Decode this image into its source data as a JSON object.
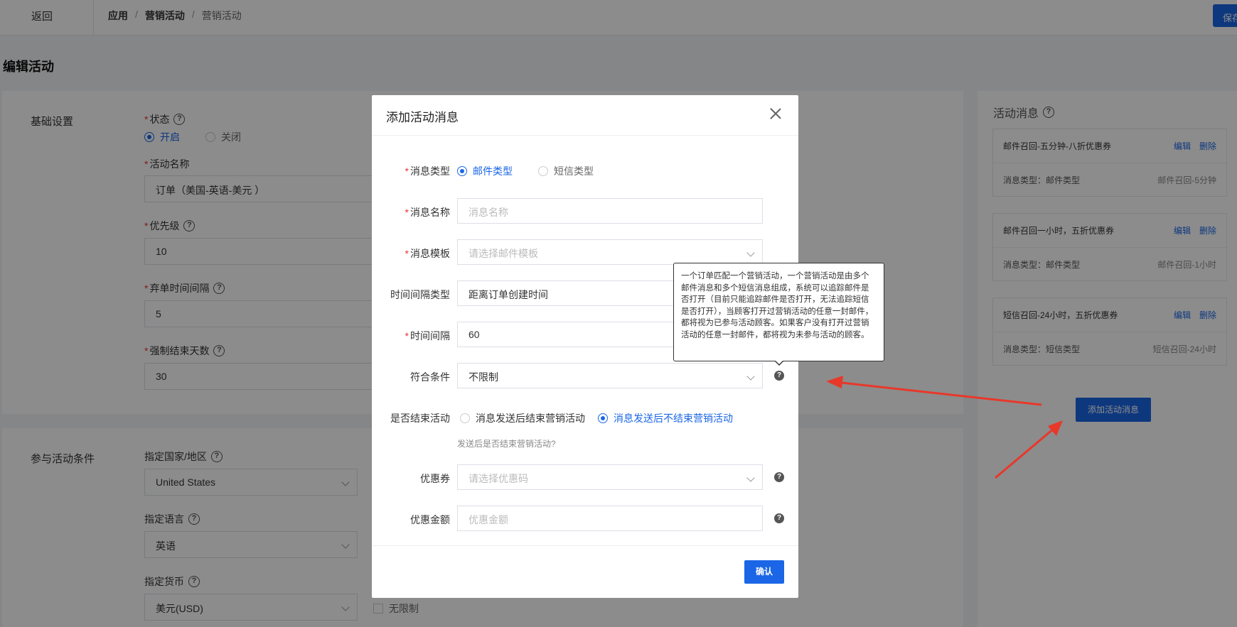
{
  "topbar": {
    "back_label": "返回",
    "breadcrumb": [
      "应用",
      "营销活动",
      "营销活动"
    ],
    "save_label": "保存"
  },
  "page_title": "编辑活动",
  "basic": {
    "section_title": "基础设置",
    "status_label": "状态",
    "status_on": "开启",
    "status_off": "关闭",
    "name_label": "活动名称",
    "name_value": "订单（美国-英语-美元 ）",
    "priority_label": "优先级",
    "priority_value": "10",
    "abandon_label": "弃单时间间隔",
    "abandon_value": "5",
    "force_end_label": "强制结束天数",
    "force_end_value": "30"
  },
  "conditions": {
    "section_title": "参与活动条件",
    "country_label": "指定国家/地区",
    "country_value": "United States",
    "language_label": "指定语言",
    "language_value": "英语",
    "currency_label": "指定货币",
    "currency_value": "美元(USD)",
    "unlimited_label": "无限制"
  },
  "messages": {
    "title": "活动消息",
    "items": [
      {
        "name": "邮件召回-五分钟-八折优惠券",
        "edit": "编辑",
        "delete": "删除",
        "type": "消息类型：邮件类型",
        "tpl": "邮件召回-5分钟"
      },
      {
        "name": "邮件召回一小时，五折优惠券",
        "edit": "编辑",
        "delete": "删除",
        "type": "消息类型：邮件类型",
        "tpl": "邮件召回-1小时"
      },
      {
        "name": "短信召回-24小时，五折优惠券",
        "edit": "编辑",
        "delete": "删除",
        "type": "消息类型：短信类型",
        "tpl": "短信召回-24小时"
      }
    ],
    "add_label": "添加活动消息"
  },
  "modal": {
    "title": "添加活动消息",
    "msg_type_label": "消息类型",
    "msg_type_email": "邮件类型",
    "msg_type_sms": "短信类型",
    "msg_name_label": "消息名称",
    "msg_name_placeholder": "消息名称",
    "msg_tpl_label": "消息模板",
    "msg_tpl_placeholder": "请选择邮件模板",
    "interval_type_label": "时间间隔类型",
    "interval_type_value": "距离订单创建时间",
    "interval_label": "时间间隔",
    "interval_value": "60",
    "condition_label": "符合条件",
    "condition_value": "不限制",
    "end_label": "是否结束活动",
    "end_opt1": "消息发送后结束营销活动",
    "end_opt2": "消息发送后不结束营销活动",
    "end_hint": "发送后是否结束营销活动?",
    "coupon_label": "优惠券",
    "coupon_placeholder": "请选择优惠码",
    "amount_label": "优惠金额",
    "amount_placeholder": "优惠金额",
    "confirm_label": "确认"
  },
  "tooltip": {
    "text": "一个订单匹配一个营销活动，一个营销活动是由多个邮件消息和多个短信消息组成，系统可以追踪邮件是否打开（目前只能追踪邮件是否打开，无法追踪短信是否打开），当顾客打开过营销活动的任意一封邮件，都将视为已参与活动顾客。如果客户没有打开过营销活动的任意一封邮件，都将视为未参与活动的顾客。"
  },
  "colors": {
    "accent": "#1a66e6",
    "required": "#e33333",
    "annotation_arrow": "#e8382a"
  }
}
